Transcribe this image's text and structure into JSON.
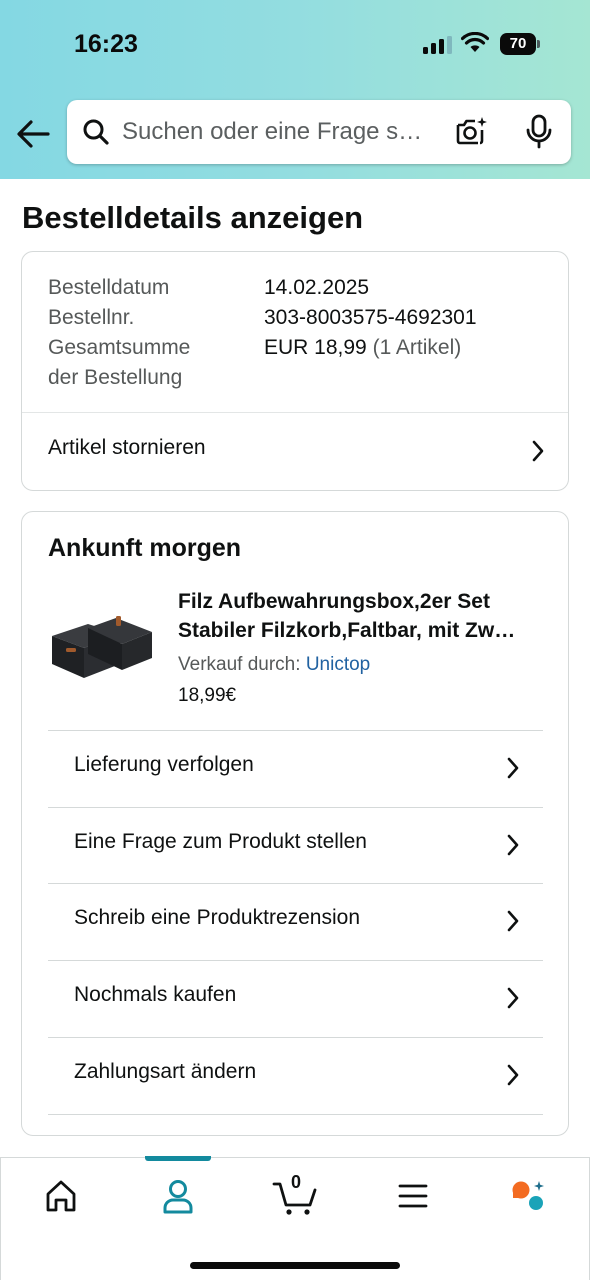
{
  "status_bar": {
    "time": "16:23",
    "battery": "70"
  },
  "search": {
    "placeholder": "Suchen oder eine Frage s…"
  },
  "page_title": "Bestelldetails anzeigen",
  "order_summary": {
    "rows": [
      {
        "label": "Bestelldatum",
        "value": "14.02.2025"
      },
      {
        "label": "Bestellnr.",
        "value": "303-8003575-4692301"
      },
      {
        "label_line1": "Gesamtsumme",
        "label_line2": "der Bestellung",
        "value": "EUR 18,99",
        "value_suffix": "(1 Artikel)"
      }
    ],
    "cancel_label": "Artikel stornieren"
  },
  "delivery": {
    "title": "Ankunft morgen",
    "product": {
      "title_line1": "Filz Aufbewahrungsbox,2er Set",
      "title_line2": "Stabiler Filzkorb,Faltbar, mit Zw…",
      "seller_prefix": "Verkauf durch:",
      "seller_name": "Unictop",
      "price": "18,99€"
    },
    "actions": [
      {
        "label": "Lieferung verfolgen"
      },
      {
        "label": "Eine Frage zum Produkt stellen"
      },
      {
        "label": "Schreib eine Produktrezension"
      },
      {
        "label": "Nochmals kaufen"
      },
      {
        "label": "Zahlungsart ändern"
      }
    ]
  },
  "tabbar": {
    "cart_count": "0",
    "active_tab": "account",
    "accent_color": "#138a9e"
  },
  "colors": {
    "header_gradient_start": "#84d8e3",
    "header_gradient_end": "#a5e6d3",
    "link": "#2162a1",
    "assistant_orange": "#f36b21",
    "assistant_teal": "#1aa3b8"
  }
}
